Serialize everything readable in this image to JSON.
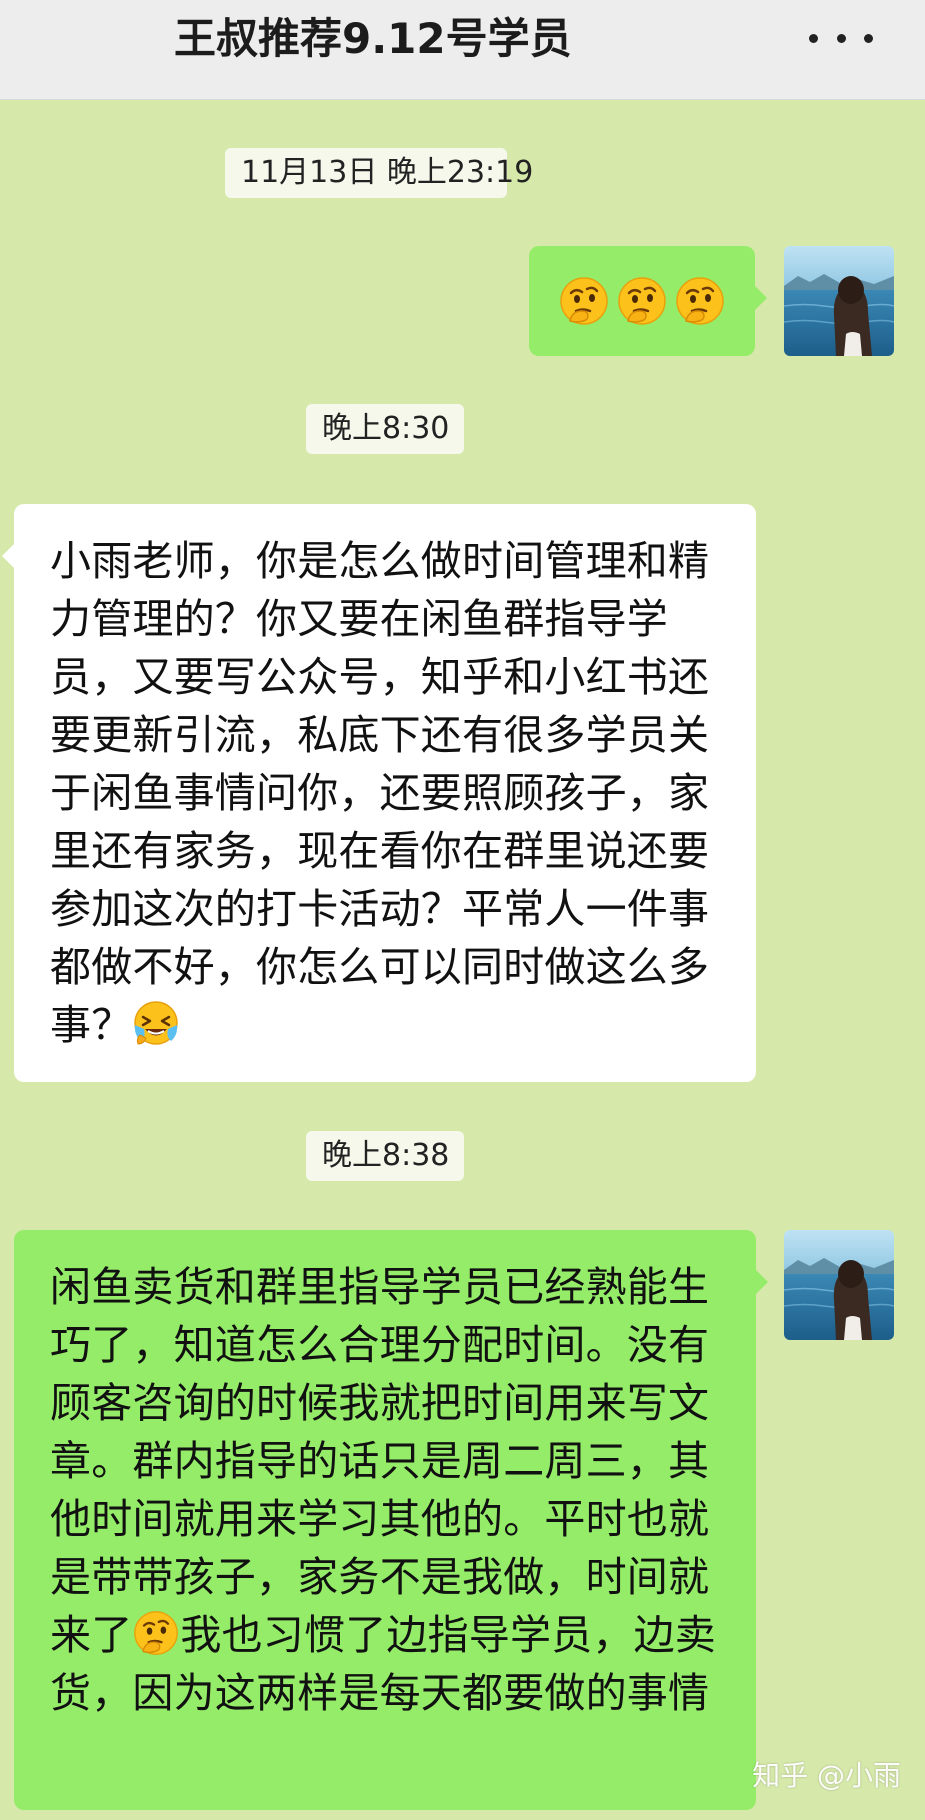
{
  "header": {
    "title": "王叔推荐9.12号学员",
    "more_icon": "more-dots-icon"
  },
  "colors": {
    "chat_background": "#d6e9aa",
    "outgoing_bubble": "#95ec69",
    "incoming_bubble": "#ffffff",
    "header_background": "#ededed"
  },
  "messages": [
    {
      "type": "timestamp",
      "text": "11月13日 晚上23:19"
    },
    {
      "type": "message",
      "direction": "outgoing",
      "emoji": [
        "thinking-face-emoji",
        "thinking-face-emoji",
        "thinking-face-emoji"
      ]
    },
    {
      "type": "timestamp",
      "text": "晚上8:30"
    },
    {
      "type": "message",
      "direction": "incoming",
      "text": "小雨老师，你是怎么做时间管理和精力管理的？你又要在闲鱼群指导学员，又要写公众号，知乎和小红书还要更新引流，私底下还有很多学员关于闲鱼事情问你，还要照顾孩子，家里还有家务，现在看你在群里说还要参加这次的打卡活动？平常人一件事都做不好，你怎么可以同时做这么多事？",
      "trailing_emoji": "crying-laughing-emoji"
    },
    {
      "type": "timestamp",
      "text": "晚上8:38"
    },
    {
      "type": "message",
      "direction": "outgoing",
      "text_before_emoji": "闲鱼卖货和群里指导学员已经熟能生巧了，知道怎么合理分配时间。没有顾客咨询的时候我就把时间用来写文章。群内指导的话只是周二周三，其他时间就用来学习其他的。平时也就是带带孩子，家务不是我做，时间就来了",
      "inline_emoji": "thinking-face-emoji",
      "text_after_emoji": "我也习惯了边指导学员，边卖货，因为这两样是每天都要做的事情"
    }
  ],
  "watermark": "知乎 @小雨"
}
